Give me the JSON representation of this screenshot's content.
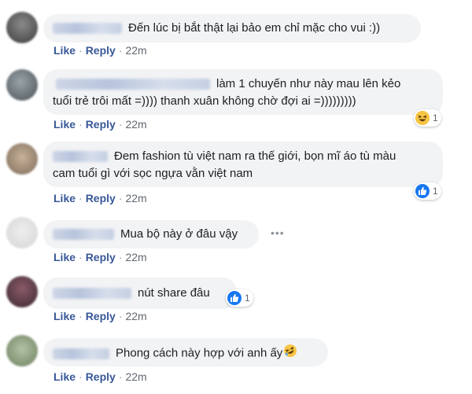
{
  "colors": {
    "bubble_bg": "#f2f3f5",
    "link": "#385898",
    "like_blue": "#1877f2"
  },
  "comments": [
    {
      "text": "Đến lúc bị bắt thật lại bảo em chỉ mặc cho vui :))",
      "actions": {
        "like": "Like",
        "reply": "Reply",
        "time": "22m"
      }
    },
    {
      "text_lines": [
        "làm 1 chuyến như này mau lên kẻo",
        "tuổi trẻ trôi mất =)))) thanh xuân không chờ đợi ai =)))))))))"
      ],
      "reaction": {
        "icon": "haha-icon",
        "count": "1"
      },
      "actions": {
        "like": "Like",
        "reply": "Reply",
        "time": "22m"
      }
    },
    {
      "text_lines": [
        "Đem fashion tù việt nam ra thế giới, bọn mĩ áo tù màu",
        "cam tuổi gì với sọc ngựa vằn việt nam"
      ],
      "reaction": {
        "icon": "like-icon",
        "count": "1"
      },
      "actions": {
        "like": "Like",
        "reply": "Reply",
        "time": "22m"
      }
    },
    {
      "text": "Mua bộ này ở đâu vậy",
      "more": "•••",
      "actions": {
        "like": "Like",
        "reply": "Reply",
        "time": "22m"
      }
    },
    {
      "text": "nút share đâu",
      "reaction": {
        "icon": "like-icon",
        "count": "1"
      },
      "actions": {
        "like": "Like",
        "reply": "Reply",
        "time": "22m"
      }
    },
    {
      "text": "Phong cách này hợp với anh ấy",
      "emoji": "rofl-emoji",
      "actions": {
        "like": "Like",
        "reply": "Reply",
        "time": "22m"
      }
    }
  ]
}
